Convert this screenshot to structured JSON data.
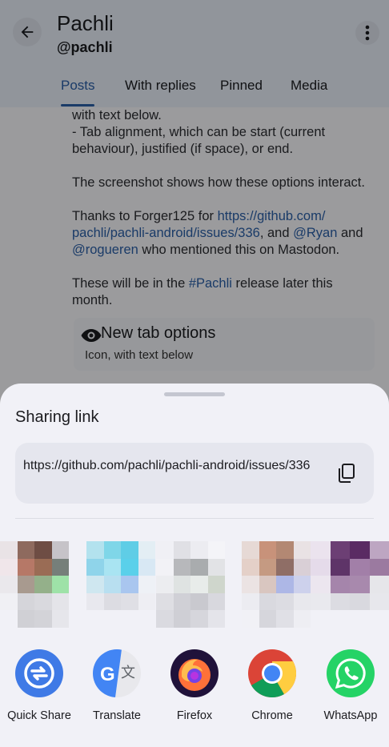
{
  "app": {
    "title": "Pachli",
    "handle": "@pachli",
    "tabs": [
      {
        "label": "Posts",
        "active": true
      },
      {
        "label": "With replies",
        "active": false
      },
      {
        "label": "Pinned",
        "active": false
      },
      {
        "label": "Media",
        "active": false
      }
    ],
    "post": {
      "lines_a": [
        "with text below.",
        "- Tab alignment, which can be start (current",
        "behaviour), justified (if space), or end."
      ],
      "line_b": "The screenshot shows how these options interact.",
      "thanks_1": "Thanks to Forger125 for ",
      "thanks_link_1": "https://github.com/",
      "thanks_link_2": "pachli/pachli-android/issues/336",
      "thanks_2": ", and ",
      "thanks_mention_1": "@Ryan",
      "thanks_3": " and",
      "thanks_mention_2": "@rogueren",
      "thanks_4": " who mentioned this on Mastodon.",
      "release_1": "These will be in the ",
      "release_tag": "#Pachli",
      "release_2": " release later this",
      "release_3": "month."
    },
    "preview": {
      "title": "New tab options",
      "subtitle": "Icon, with text below"
    }
  },
  "sheet": {
    "title": "Sharing link",
    "link_text": "https://github.com/pachli/pachli-android/issues/336",
    "apps": [
      {
        "label": "Quick Share",
        "icon": "quick-share-icon"
      },
      {
        "label": "Translate",
        "icon": "translate-icon"
      },
      {
        "label": "Firefox",
        "icon": "firefox-icon"
      },
      {
        "label": "Chrome",
        "icon": "chrome-icon"
      },
      {
        "label": "WhatsApp",
        "icon": "whatsapp-icon"
      }
    ]
  },
  "colors": {
    "accent": "#2a5fa8",
    "sheet_bg": "#f1f1f7",
    "link_box_bg": "#e5e6ee"
  }
}
